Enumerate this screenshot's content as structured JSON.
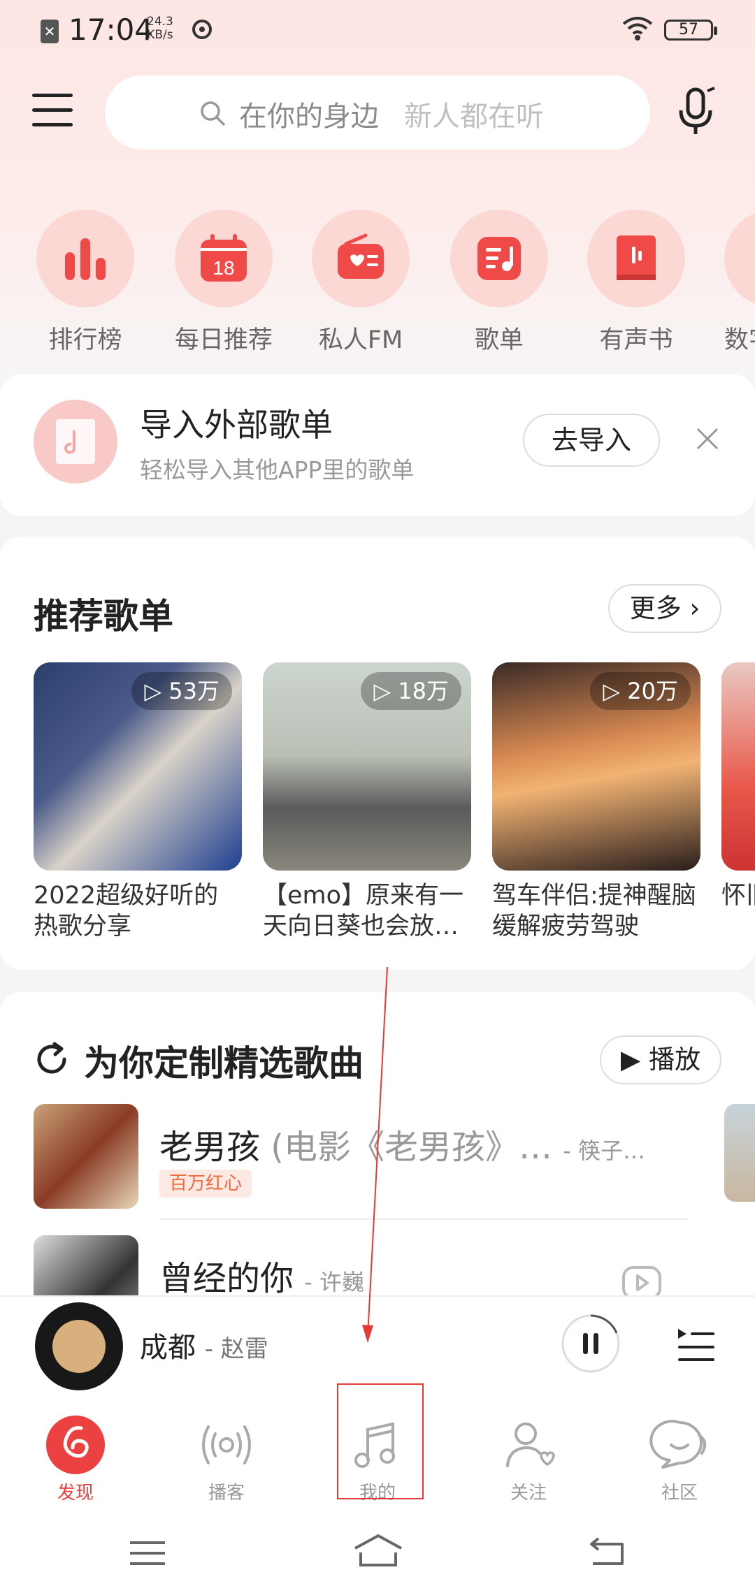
{
  "status_bar": {
    "time": "17:04",
    "speed_value": "24.3",
    "speed_unit": "KB/s",
    "battery": "57"
  },
  "search": {
    "placeholder_main": "在你的身边",
    "placeholder_hint": "新人都在听"
  },
  "quick_entries": [
    {
      "label": "排行榜",
      "icon": "chart-bars-icon"
    },
    {
      "label": "每日推荐",
      "icon": "calendar-icon",
      "badge": "18"
    },
    {
      "label": "私人FM",
      "icon": "radio-icon"
    },
    {
      "label": "歌单",
      "icon": "playlist-icon"
    },
    {
      "label": "有声书",
      "icon": "audiobook-icon"
    },
    {
      "label": "数字",
      "icon": "digital-album-icon"
    }
  ],
  "import_banner": {
    "title": "导入外部歌单",
    "subtitle": "轻松导入其他APP里的歌单",
    "button": "去导入"
  },
  "recommended": {
    "title": "推荐歌单",
    "more": "更多",
    "playlists": [
      {
        "plays": "53万",
        "name": "2022超级好听的热歌分享"
      },
      {
        "plays": "18万",
        "name": "【emo】原来有一天向日葵也会放…"
      },
      {
        "plays": "20万",
        "name": "驾车伴侣:提神醒脑 缓解疲劳驾驶"
      },
      {
        "plays": "",
        "name": "怀旧忆里"
      }
    ]
  },
  "daily": {
    "title": "为你定制精选歌曲",
    "play": "播放",
    "songs": [
      {
        "title": "老男孩",
        "alt": "(电影《老男孩》…",
        "artist": "- 筷子…",
        "tag": "百万红心"
      },
      {
        "title": "曾经的你",
        "alt": "",
        "artist": "- 许巍",
        "tag": ""
      }
    ]
  },
  "mini_player": {
    "title": "成都",
    "artist": "- 赵雷"
  },
  "tabs": [
    {
      "label": "发现",
      "icon": "discover-icon",
      "active": true
    },
    {
      "label": "播客",
      "icon": "podcast-icon",
      "active": false
    },
    {
      "label": "我的",
      "icon": "music-note-icon",
      "active": false
    },
    {
      "label": "关注",
      "icon": "follow-user-icon",
      "active": false
    },
    {
      "label": "社区",
      "icon": "community-icon",
      "active": false
    }
  ],
  "colors": {
    "brand_red": "#ec4141",
    "entry_bg": "#fcd8d5",
    "tag_orange": "#ee6a3c"
  }
}
